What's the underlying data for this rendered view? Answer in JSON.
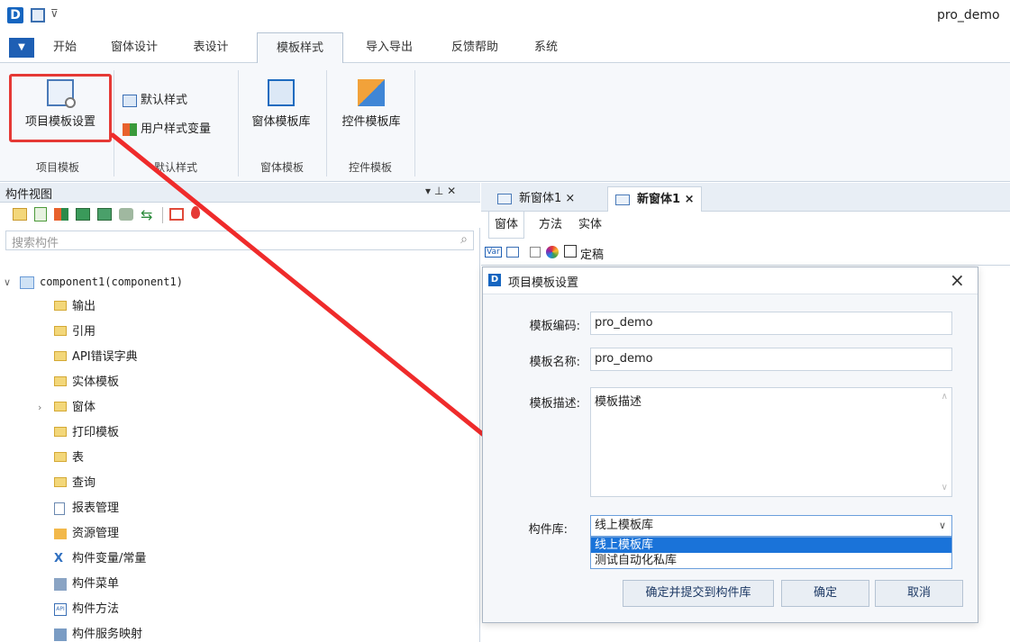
{
  "app": {
    "doc_title": "pro_demo"
  },
  "menubar": {
    "items": [
      {
        "label": "开始"
      },
      {
        "label": "窗体设计"
      },
      {
        "label": "表设计"
      },
      {
        "label": "模板样式"
      },
      {
        "label": "导入导出"
      },
      {
        "label": "反馈帮助"
      },
      {
        "label": "系统"
      }
    ]
  },
  "ribbon": {
    "project_template_settings": "项目模板设置",
    "default_style": "默认样式",
    "user_style_vars": "用户样式变量",
    "form_template_lib": "窗体模板库",
    "control_template_lib": "控件模板库",
    "groups": [
      "项目模板",
      "默认样式",
      "窗体模板",
      "控件模板"
    ]
  },
  "component_view": {
    "title": "构件视图",
    "pin_glyph": "▾ ⊥ ✕",
    "search_placeholder": "搜索构件",
    "root": "component1(component1)",
    "items": [
      "输出",
      "引用",
      "API错误字典",
      "实体模板",
      "窗体",
      "打印模板",
      "表",
      "查询",
      "报表管理",
      "资源管理",
      "构件变量/常量",
      "构件菜单",
      "构件方法",
      "构件服务映射"
    ]
  },
  "doc_tabs": [
    "新窗体1 ×",
    "新窗体1 ×"
  ],
  "sub_tabs": [
    "窗体",
    "方法",
    "实体"
  ],
  "toolbar_small": {
    "var_label": "Var",
    "lock_label": "定稿"
  },
  "dialog": {
    "title": "项目模板设置",
    "close": "×",
    "code_label": "模板编码:",
    "code_value": "pro_demo",
    "name_label": "模板名称:",
    "name_value": "pro_demo",
    "desc_label": "模板描述:",
    "desc_value": "模板描述",
    "lib_label": "构件库:",
    "lib_selected": "线上模板库",
    "lib_options": [
      "线上模板库",
      "测试自动化私库"
    ],
    "btn_commit": "确定并提交到构件库",
    "btn_ok": "确定",
    "btn_cancel": "取消"
  },
  "colors": {
    "highlight_box": "#e53935",
    "arrow": "#ef2b2b",
    "selected_option": "#1a73d9",
    "brand": "#1565c0"
  }
}
